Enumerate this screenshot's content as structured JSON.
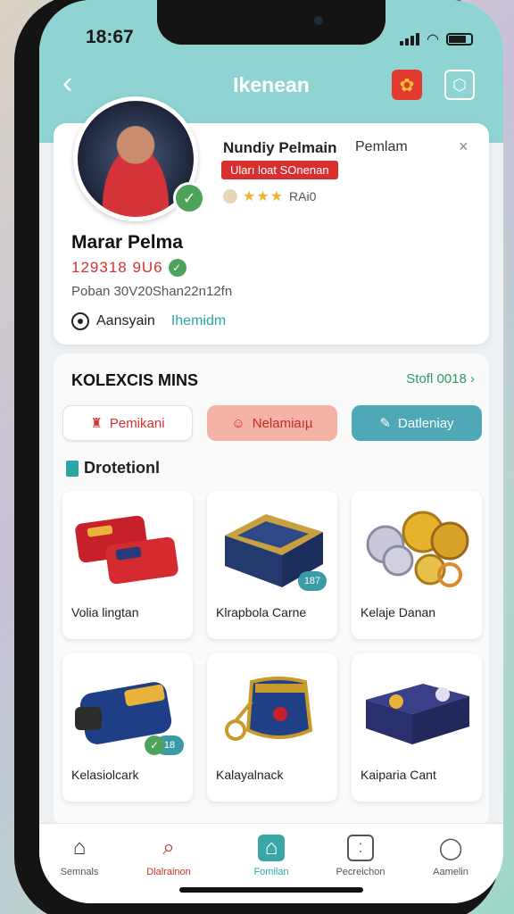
{
  "status_bar": {
    "time": "18:67"
  },
  "header": {
    "title": "Ikenean"
  },
  "profile": {
    "name_top": "Nundiy Pelmain",
    "side_label": "Pemlam",
    "close_glyph": "×",
    "badge": "Uları loat SOnenan",
    "rating_text": "RAi0",
    "stars": "★★★",
    "name": "Marar Pelma",
    "id_text": "129318 9U6",
    "details": "Poban 30V20Shan22n12fn",
    "row_label": "Aansyain",
    "row_link": "Ihemidm"
  },
  "collection": {
    "title": "KOLEXCIS MINS",
    "see_all": "Stofl 0018 ›",
    "chips": [
      {
        "label": "Pemikani",
        "icon": "trophy-icon"
      },
      {
        "label": "Nelamiaıµ",
        "icon": "smile-icon"
      },
      {
        "label": "Datleniay",
        "icon": "tag-icon"
      }
    ],
    "section_label": "Drotetionl",
    "items": [
      {
        "name": "Volia lingtan",
        "icon": "red-cases-icon"
      },
      {
        "name": "Klrapbola Carne",
        "icon": "card-box-icon",
        "badge": "187"
      },
      {
        "name": "Kelaje Danan",
        "icon": "coins-icon"
      },
      {
        "name": "Kelasiolcark",
        "icon": "blue-case-icon",
        "badge": "18"
      },
      {
        "name": "Kalayalnack",
        "icon": "crown-icon"
      },
      {
        "name": "Kaiparia Cant",
        "icon": "card-box-icon"
      }
    ]
  },
  "nav": [
    {
      "label": "Semnals",
      "icon": "home-icon"
    },
    {
      "label": "Dlalrainon",
      "icon": "search-icon"
    },
    {
      "label": "Fomilan",
      "icon": "home-active-icon"
    },
    {
      "label": "Pecreichon",
      "icon": "square-face-icon"
    },
    {
      "label": "Aamelin",
      "icon": "person-icon"
    }
  ],
  "colors": {
    "header": "#8fd3d2",
    "accent_red": "#d8302f",
    "accent_teal": "#2aa6a6"
  }
}
